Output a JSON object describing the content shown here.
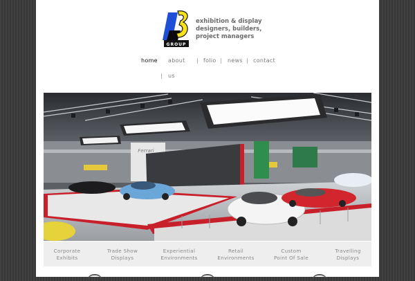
{
  "logo": {
    "mark_text": "B3",
    "group_text": "GROUP",
    "tagline": [
      "exhibition & display",
      "designers, builders,",
      "project managers"
    ]
  },
  "nav": {
    "home": "home",
    "about": "about",
    "folio": "folio",
    "news": "news",
    "contact": "contact",
    "us": "us",
    "separator": "|"
  },
  "hero": {
    "brand_sign": "Ferrari"
  },
  "services": [
    {
      "line1": "Corporate",
      "line2": "Exhibits"
    },
    {
      "line1": "Trade Show",
      "line2": "Displays"
    },
    {
      "line1": "Experiential",
      "line2": "Environments"
    },
    {
      "line1": "Retail",
      "line2": "Environments"
    },
    {
      "line1": "Custom",
      "line2": "Point Of Sale"
    },
    {
      "line1": "Travelling",
      "line2": "Displays"
    }
  ],
  "colors": {
    "logo_blue": "#1f4fd6",
    "logo_yellow": "#f5e21a",
    "ferrari_red": "#c8202a"
  }
}
